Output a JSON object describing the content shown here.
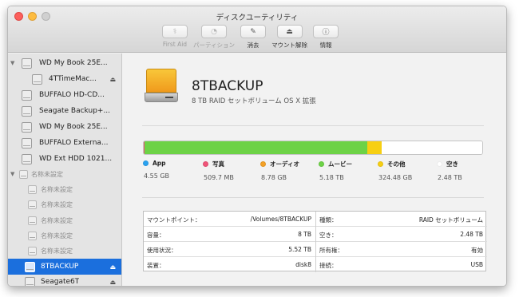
{
  "window": {
    "title": "ディスクユーティリティ"
  },
  "toolbar": {
    "buttons": [
      {
        "label": "First Aid",
        "icon": "stethoscope-icon",
        "glyph": "⚕",
        "enabled": false
      },
      {
        "label": "パーティション",
        "icon": "pie-icon",
        "glyph": "◔",
        "enabled": false
      },
      {
        "label": "消去",
        "icon": "erase-icon",
        "glyph": "✎",
        "enabled": true
      },
      {
        "label": "マウント解除",
        "icon": "unmount-icon",
        "glyph": "⏏",
        "enabled": true
      },
      {
        "label": "情報",
        "icon": "info-icon",
        "glyph": "ⓘ",
        "enabled": true
      }
    ]
  },
  "sidebar": {
    "items": [
      {
        "label": "WD My Book 25E...",
        "eject": false
      },
      {
        "label": "4TTimeMac...",
        "eject": true
      },
      {
        "label": "BUFFALO HD-CD...",
        "eject": false
      },
      {
        "label": "Seagate Backup+...",
        "eject": false
      },
      {
        "label": "WD My Book 25E...",
        "eject": false
      },
      {
        "label": "BUFFALO Externa...",
        "eject": false
      },
      {
        "label": "WD Ext HDD 1021...",
        "eject": false
      },
      {
        "label": "名称未設定",
        "eject": false
      },
      {
        "label": "名称未設定",
        "eject": false
      },
      {
        "label": "名称未設定",
        "eject": false
      },
      {
        "label": "名称未設定",
        "eject": false
      },
      {
        "label": "名称未設定",
        "eject": false
      },
      {
        "label": "名称未設定",
        "eject": false
      },
      {
        "label": "8TBACKUP",
        "eject": true,
        "selected": true
      },
      {
        "label": "Seagate6T",
        "eject": true
      }
    ],
    "eject_glyph": "⏏"
  },
  "volume": {
    "name": "8TBACKUP",
    "description": "8 TB RAID セットボリューム OS X 拡張"
  },
  "usage": {
    "segments": [
      {
        "name": "App",
        "value": "4.55 GB",
        "color": "#2aa2f0",
        "fraction": 0.0006
      },
      {
        "name": "写真",
        "value": "509.7 MB",
        "color": "#f05478",
        "fraction": 0.0001
      },
      {
        "name": "オーディオ",
        "value": "8.78 GB",
        "color": "#f4a126",
        "fraction": 0.0011
      },
      {
        "name": "ムービー",
        "value": "5.18 TB",
        "color": "#6dd246",
        "fraction": 0.658
      },
      {
        "name": "その他",
        "value": "324.48 GB",
        "color": "#f7cf12",
        "fraction": 0.0412
      },
      {
        "name": "空き",
        "value": "2.48 TB",
        "color": "#ffffff",
        "fraction": 0.299
      }
    ]
  },
  "info": {
    "left": [
      {
        "key": "マウントポイント：",
        "value": "/Volumes/8TBACKUP"
      },
      {
        "key": "容量：",
        "value": "8 TB"
      },
      {
        "key": "使用状況：",
        "value": "5.52 TB"
      },
      {
        "key": "装置：",
        "value": "disk8"
      }
    ],
    "right": [
      {
        "key": "種類：",
        "value": "RAID セットボリューム"
      },
      {
        "key": "空き：",
        "value": "2.48 TB"
      },
      {
        "key": "所有権：",
        "value": "有効"
      },
      {
        "key": "接続：",
        "value": "USB"
      }
    ]
  }
}
